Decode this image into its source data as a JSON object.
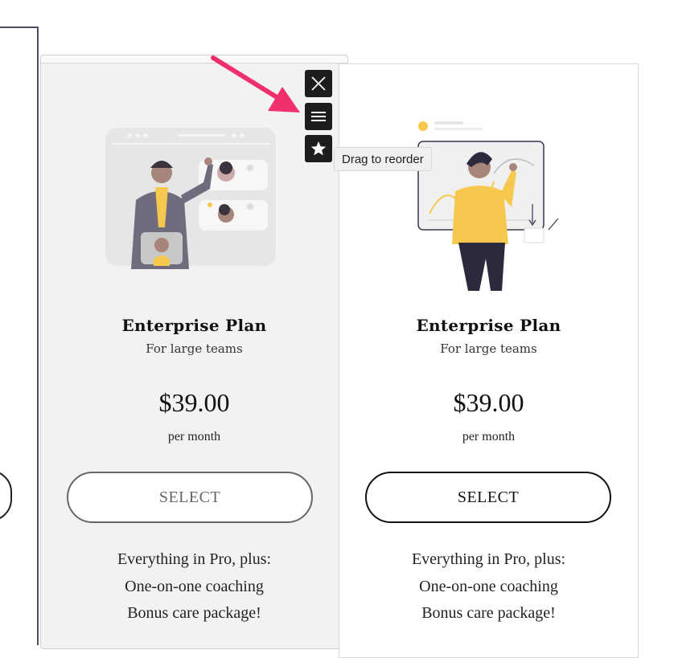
{
  "cards": [
    {
      "title": "Enterprise Plan",
      "subtitle": "For large teams",
      "price": "$39.00",
      "period": "per month",
      "button_label": "SELECT",
      "features": [
        "Everything in Pro, plus:",
        "One-on-one coaching",
        "Bonus care package!"
      ]
    },
    {
      "title": "Enterprise Plan",
      "subtitle": "For large teams",
      "price": "$39.00",
      "period": "per month",
      "button_label": "SELECT",
      "features": [
        "Everything in Pro, plus:",
        "One-on-one coaching",
        "Bonus care package!"
      ]
    }
  ],
  "toolbar": {
    "tooltip": "Drag to reorder",
    "icons": [
      "close-icon",
      "drag-handle-icon",
      "star-icon"
    ]
  },
  "colors": {
    "arrow": "#f0306c",
    "toolbar_bg": "#1d1d1d",
    "illustration_yellow": "#f6c94e",
    "illustration_dark": "#2d2a3e"
  }
}
